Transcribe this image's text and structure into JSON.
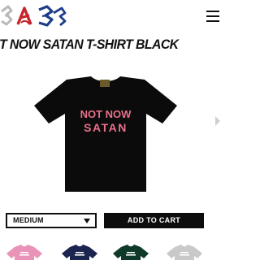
{
  "header": {
    "logo_icon": "sas-logo-icon",
    "menu_icon": "hamburger-menu-icon"
  },
  "product": {
    "title": "T NOW SATAN T-SHIRT BLACK",
    "image": {
      "shirt_color": "#0b0b0b",
      "print_line1": "NOT NOW",
      "print_line2": "SATAN",
      "print_color": "#e8708a"
    }
  },
  "controls": {
    "size_value": "MEDIUM",
    "size_caret_icon": "dropdown-caret-icon",
    "add_to_cart_label": "ADD TO CART",
    "next_icon": "chevron-right-icon"
  },
  "thumbnails": [
    {
      "color": "#e993b8",
      "print_color": "#ffffff"
    },
    {
      "color": "#1c2550",
      "print_color": "#ffffff"
    },
    {
      "color": "#0f3a2a",
      "print_color": "#ffffff"
    },
    {
      "color": "#c9c9c9",
      "print_color": "#ffffff"
    }
  ],
  "colors": {
    "text": "#111111",
    "button_bg": "#0d0d0d",
    "button_text": "#ffffff"
  }
}
